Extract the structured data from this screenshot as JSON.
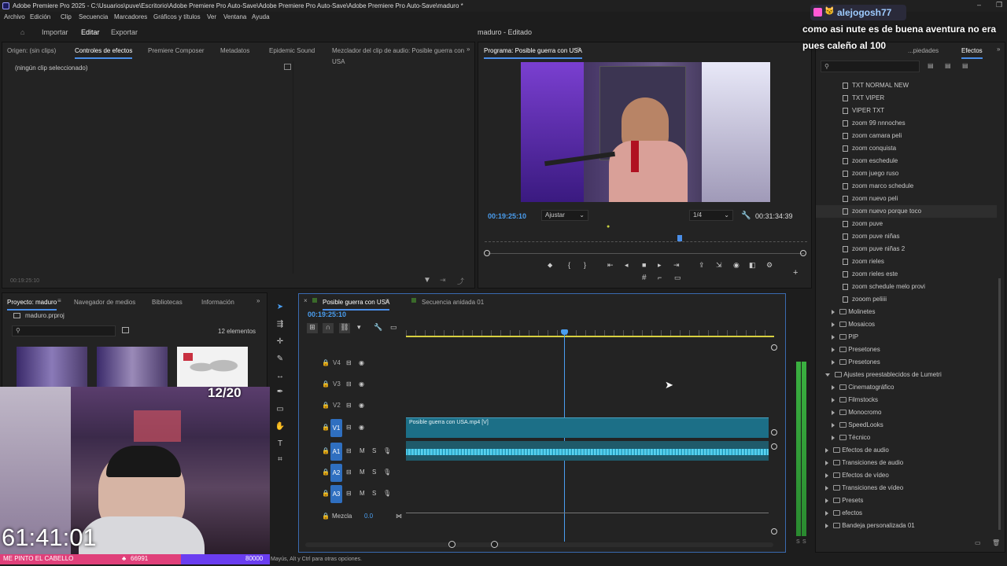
{
  "window": {
    "title": "Adobe Premiere Pro 2025 - C:\\Usuarios\\puve\\Escritorio\\Adobe Premiere Pro Auto-Save\\Adobe Premiere Pro Auto-Save\\Adobe Premiere Pro Auto-Save\\maduro *"
  },
  "menu": [
    "Archivo",
    "Edición",
    "Clip",
    "Secuencia",
    "Marcadores",
    "Gráficos y títulos",
    "Ver",
    "Ventana",
    "Ayuda"
  ],
  "header": {
    "import": "Importar",
    "edit": "Editar",
    "export": "Exportar",
    "project_status": "maduro - Editado"
  },
  "source_panel": {
    "tabs": [
      "Origen: (sin clips)",
      "Controles de efectos",
      "Premiere Composer",
      "Metadatos",
      "Epidemic Sound",
      "Mezclador del clip de audio: Posible guerra con USA"
    ],
    "no_clip": "(ningún clip seleccionado)",
    "timecode": "00:19:25:10"
  },
  "program_monitor": {
    "title": "Programa: Posible guerra con USA",
    "timecode": "00:19:25:10",
    "fit": "Ajustar",
    "resolution": "1/4",
    "duration": "00:31:34:39"
  },
  "project_panel": {
    "tabs": [
      "Proyecto: maduro",
      "Navegador de medios",
      "Bibliotecas",
      "Información"
    ],
    "file": "maduro.prproj",
    "count": "12 elementos"
  },
  "timeline": {
    "tabs": [
      "Posible guerra con USA",
      "Secuencia anidada 01"
    ],
    "timecode": "00:19:25:10",
    "tracks": [
      "V4",
      "V3",
      "V2",
      "V1",
      "A1",
      "A2",
      "A3"
    ],
    "mix_label": "Mezcla",
    "mix_value": "0.0",
    "clip_label": "Posible guerra con USA.mp4 [V]",
    "playhead_fraction": 0.43
  },
  "effects_panel": {
    "tab_partial": "...piedades",
    "tab": "Efectos",
    "items": [
      {
        "label": "TXT NORMAL NEW",
        "kind": "preset"
      },
      {
        "label": "TXT VIPER",
        "kind": "preset"
      },
      {
        "label": "VIPER TXT",
        "kind": "preset"
      },
      {
        "label": "zoom 99 nnnoches",
        "kind": "preset"
      },
      {
        "label": "zoom camara peli",
        "kind": "preset"
      },
      {
        "label": "zoom conquista",
        "kind": "preset"
      },
      {
        "label": "zoom eschedule",
        "kind": "preset"
      },
      {
        "label": "zoom juego ruso",
        "kind": "preset"
      },
      {
        "label": "zoom marco schedule",
        "kind": "preset"
      },
      {
        "label": "zoom nuevo peli",
        "kind": "preset"
      },
      {
        "label": "zoom nuevo porque toco",
        "kind": "preset"
      },
      {
        "label": "zoom puve",
        "kind": "preset"
      },
      {
        "label": "zoom puve niñas",
        "kind": "preset"
      },
      {
        "label": "zoom puve niñas 2",
        "kind": "preset"
      },
      {
        "label": "zoom rieles",
        "kind": "preset"
      },
      {
        "label": "zoom rieles este",
        "kind": "preset"
      },
      {
        "label": "zoom schedule melo provi",
        "kind": "preset"
      },
      {
        "label": "zooom peliiii",
        "kind": "preset"
      },
      {
        "label": "Molinetes",
        "kind": "folder"
      },
      {
        "label": "Mosaicos",
        "kind": "folder"
      },
      {
        "label": "PIP",
        "kind": "folder"
      },
      {
        "label": "Presetones",
        "kind": "folder"
      },
      {
        "label": "Presetones",
        "kind": "folder"
      },
      {
        "label": "Ajustes preestablecidos de Lumetri",
        "kind": "root-open"
      },
      {
        "label": "Cinematográfico",
        "kind": "folder"
      },
      {
        "label": "Filmstocks",
        "kind": "folder"
      },
      {
        "label": "Monocromo",
        "kind": "folder"
      },
      {
        "label": "SpeedLooks",
        "kind": "folder"
      },
      {
        "label": "Técnico",
        "kind": "folder"
      },
      {
        "label": "Efectos de audio",
        "kind": "root"
      },
      {
        "label": "Transiciones de audio",
        "kind": "root"
      },
      {
        "label": "Efectos de vídeo",
        "kind": "root"
      },
      {
        "label": "Transiciones de vídeo",
        "kind": "root"
      },
      {
        "label": "Presets",
        "kind": "root"
      },
      {
        "label": "efectos",
        "kind": "root"
      },
      {
        "label": "Bandeja personalizada 01",
        "kind": "root"
      }
    ]
  },
  "stream_overlay": {
    "chat_user": "alejogosh77",
    "chat_message": "como asi nute es de buena aventura no era pues caleño al 100",
    "goal_counter": "12/20",
    "stream_timer": "61:41:01",
    "ticker_text": "ME PINTO EL CABELLO",
    "ticker_count": "66991",
    "ticker_goal": "80000"
  },
  "status_bar": {
    "hint": "Mayús, Alt y Ctrl para otras opciones."
  },
  "colors": {
    "accent_blue": "#4a8ee8",
    "clip_teal": "#1c6f87",
    "audio_clip": "#1a8fb0",
    "chat_pink": "#ff59d6",
    "ticker_pink": "#e0407a",
    "ticker_purple": "#6a3df0"
  }
}
